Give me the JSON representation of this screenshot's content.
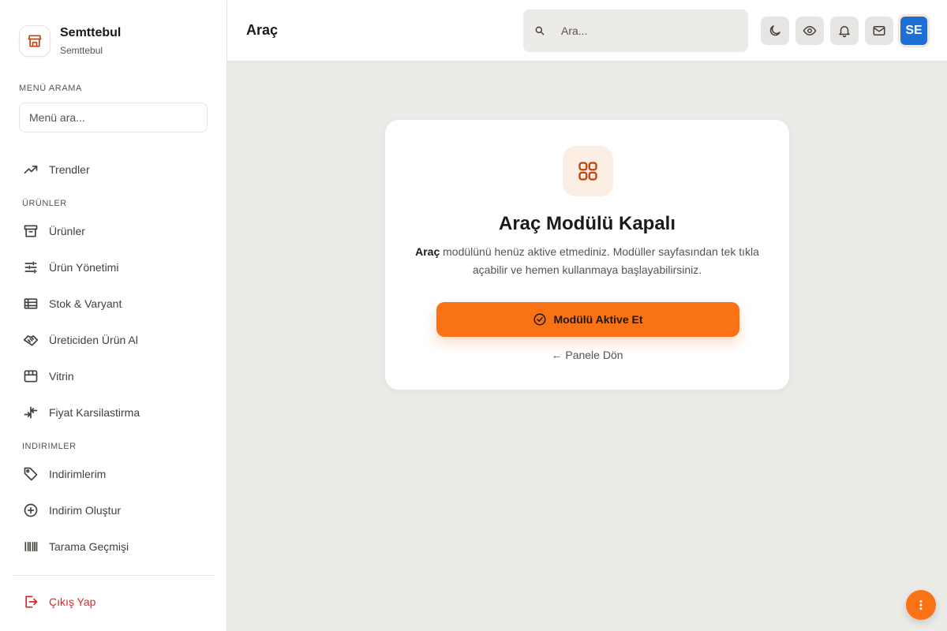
{
  "brand": {
    "name": "Semttebul",
    "subtitle": "Semttebul"
  },
  "menu_search": {
    "label": "MENÜ ARAMA",
    "placeholder": "Menü ara..."
  },
  "nav": {
    "trends": "Trendler",
    "section_products": "ÜRÜNLER",
    "products": "Ürünler",
    "product_management": "Ürün Yönetimi",
    "stock_variant": "Stok & Varyant",
    "manufacturer_products": "Üreticiden Ürün Al",
    "showcase": "Vitrin",
    "price_compare": "Fiyat Karsilastirma",
    "section_discounts": "INDIRIMLER",
    "my_discounts": "Indirimlerim",
    "create_discount": "Indirim Oluştur",
    "partial_next": "Tarama Geçmişi"
  },
  "logout": "Çıkış Yap",
  "header": {
    "title": "Araç",
    "search_placeholder": "Ara...",
    "avatar_initials": "SE"
  },
  "card": {
    "title": "Araç Modülü Kapalı",
    "desc_bold": "Araç",
    "desc_rest": " modülünü henüz aktive etmediniz. Modüller sayfasından tek tıkla açabilir ve hemen kullanmaya başlayabilirsiniz.",
    "activate_label": "Modülü Aktive Et",
    "back_label": "← Panele Dön"
  },
  "colors": {
    "accent": "#f97316",
    "avatar": "#1d6fd6",
    "danger": "#dc2626"
  }
}
